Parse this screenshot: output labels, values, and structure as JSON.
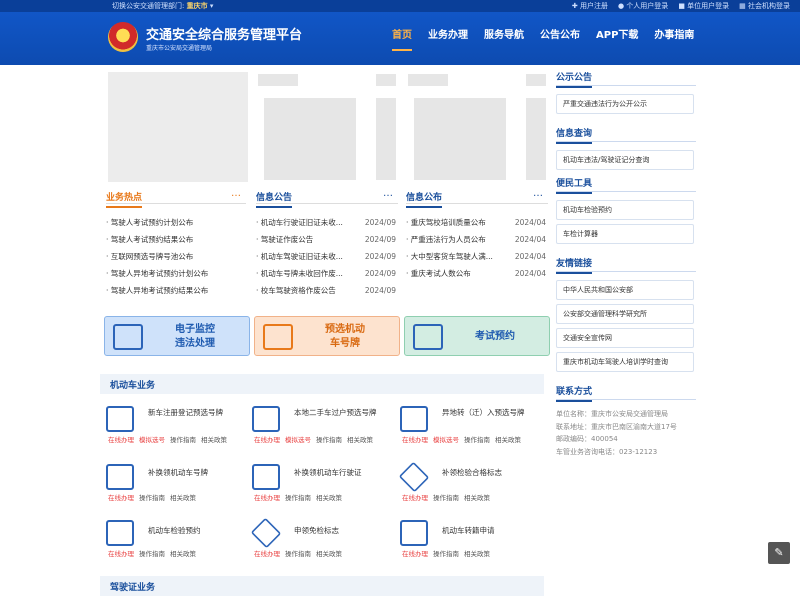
{
  "topbar": {
    "switch_label": "切换公安交通管理部门:",
    "city": "重庆市",
    "links": [
      "用户注册",
      "个人用户登录",
      "单位用户登录",
      "社会机构登录"
    ]
  },
  "header": {
    "title": "交通安全综合服务管理平台",
    "subtitle": "重庆市公安局交通管理局",
    "nav": [
      "首页",
      "业务办理",
      "服务导航",
      "公告公布",
      "APP下载",
      "办事指南"
    ]
  },
  "sections": {
    "hot": {
      "title": "业务热点",
      "more": "…",
      "items": [
        "驾驶人考试预约计划公布",
        "驾驶人考试预约结果公布",
        "互联网预选号牌号池公布",
        "驾驶人异地考试预约计划公布",
        "驾驶人异地考试预约结果公布"
      ]
    },
    "notice1": {
      "title": "信息公告",
      "more": "…",
      "items": [
        {
          "text": "机动车行驶证旧证未收...",
          "date": "2024/09"
        },
        {
          "text": "驾驶证作废公告",
          "date": "2024/09"
        },
        {
          "text": "机动车驾驶证旧证未收...",
          "date": "2024/09"
        },
        {
          "text": "机动车号牌未收回作废...",
          "date": "2024/09"
        },
        {
          "text": "校车驾驶资格作废公告",
          "date": "2024/09"
        }
      ]
    },
    "notice2": {
      "title": "信息公布",
      "more": "…",
      "items": [
        {
          "text": "重庆驾校培训质量公布",
          "date": "2024/04"
        },
        {
          "text": "严重违法行为人员公布",
          "date": "2024/04"
        },
        {
          "text": "大中型客货车驾驶人满...",
          "date": "2024/04"
        },
        {
          "text": "重庆考试人数公布",
          "date": "2024/04"
        }
      ]
    }
  },
  "quick": [
    {
      "label": "电子监控\n违法处理"
    },
    {
      "label": "预选机动\n车号牌"
    },
    {
      "label": "考试预约"
    }
  ],
  "vehicle": {
    "title": "机动车业务",
    "services": [
      {
        "name": "新车注册登记预选号牌",
        "links": [
          "在线办理",
          "模拟选号",
          "操作指南",
          "相关政策"
        ]
      },
      {
        "name": "本地二手车过户预选号牌",
        "links": [
          "在线办理",
          "模拟选号",
          "操作指南",
          "相关政策"
        ]
      },
      {
        "name": "异地转（迁）入预选号牌",
        "links": [
          "在线办理",
          "模拟选号",
          "操作指南",
          "相关政策"
        ]
      },
      {
        "name": "补换领机动车号牌",
        "links": [
          "在线办理",
          "操作指南",
          "相关政策"
        ]
      },
      {
        "name": "补换领机动车行驶证",
        "links": [
          "在线办理",
          "操作指南",
          "相关政策"
        ]
      },
      {
        "name": "补领检验合格标志",
        "links": [
          "在线办理",
          "操作指南",
          "相关政策"
        ]
      },
      {
        "name": "机动车检验预约",
        "links": [
          "在线办理",
          "操作指南",
          "相关政策"
        ]
      },
      {
        "name": "申领免检标志",
        "links": [
          "在线办理",
          "操作指南",
          "相关政策"
        ]
      },
      {
        "name": "机动车转籍申请",
        "links": [
          "在线办理",
          "操作指南",
          "相关政策"
        ]
      }
    ]
  },
  "driver": {
    "title": "驾驶证业务"
  },
  "sidebar": {
    "gongshi": {
      "title": "公示公告",
      "items": [
        "严重交通违法行为公开公示"
      ]
    },
    "query": {
      "title": "信息查询",
      "items": [
        "机动车违法/驾驶证记分查询"
      ]
    },
    "tools": {
      "title": "便民工具",
      "items": [
        "机动车检验预约",
        "车检计算器"
      ]
    },
    "links": {
      "title": "友情链接",
      "items": [
        "中华人民共和国公安部",
        "公安部交通管理科学研究所",
        "交通安全宣传网",
        "重庆市机动车驾驶人培训学时查询"
      ]
    },
    "contact": {
      "title": "联系方式",
      "lines": [
        "单位名称：重庆市公安局交通管理局",
        "联系地址：重庆市巴南区渝南大道17号",
        "邮政编码：400054",
        "车管业务咨询电话：023-12123"
      ]
    }
  },
  "feedback": {
    "icon": "✎"
  },
  "colors": {
    "brand": "#1156c7",
    "accent": "#ffb347",
    "hot": "#e8791a",
    "link_red": "#e94343"
  }
}
